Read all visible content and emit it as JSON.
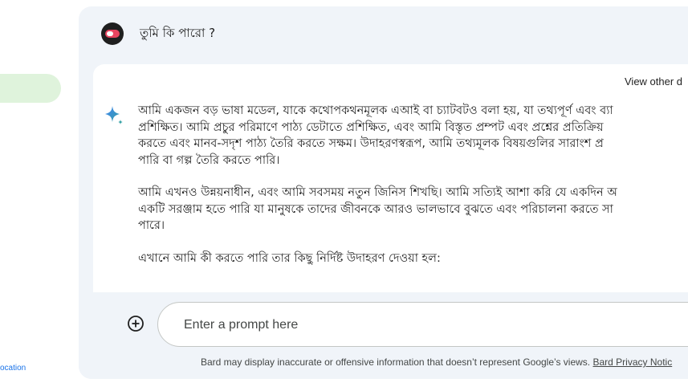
{
  "sidebar": {
    "location_text": "ocation"
  },
  "query": {
    "text": "তুমি কি পারো ?"
  },
  "response": {
    "view_other": "View other d",
    "paragraphs": [
      [
        "আমি একজন বড় ভাষা মডেল, যাকে কথোপকথনমূলক এআই বা চ্যাটবটও বলা হয়, যা তথ্যপূর্ণ এবং ব্যা",
        "প্রশিক্ষিত। আমি প্রচুর পরিমাণে পাঠ্য ডেটাতে প্রশিক্ষিত, এবং আমি বিস্তৃত প্রম্পট এবং প্রশ্নের প্রতিক্রিয়",
        "করতে এবং মানব-সদৃশ পাঠ্য তৈরি করতে সক্ষম। উদাহরণস্বরূপ, আমি তথ্যমূলক বিষয়গুলির সারাংশ প্র",
        "পারি বা গল্প তৈরি করতে পারি।"
      ],
      [
        "আমি এখনও উন্নয়নাধীন, এবং আমি সবসময় নতুন জিনিস শিখছি। আমি সত্যিই আশা করি যে একদিন অ",
        "একটি সরঞ্জাম হতে পারি যা মানুষকে তাদের জীবনকে আরও ভালভাবে বুঝতে এবং পরিচালনা করতে সা",
        "পারে।"
      ],
      [
        "এখানে আমি কী করতে পারি তার কিছু নির্দিষ্ট উদাহরণ দেওয়া হল:"
      ]
    ]
  },
  "input": {
    "placeholder": "Enter a prompt here"
  },
  "footer": {
    "disclaimer": "Bard may display inaccurate or offensive information that doesn’t represent Google’s views.",
    "privacy_link": "Bard Privacy Notic"
  },
  "colors": {
    "panel_bg": "#f0f4f9",
    "sidebar_active": "#dff3dc",
    "sparkle_blue": "#4285f4",
    "sparkle_teal": "#34a0a4"
  },
  "icons": {
    "add": "add-circle-icon",
    "sparkle": "bard-sparkle-icon",
    "avatar": "user-avatar"
  }
}
